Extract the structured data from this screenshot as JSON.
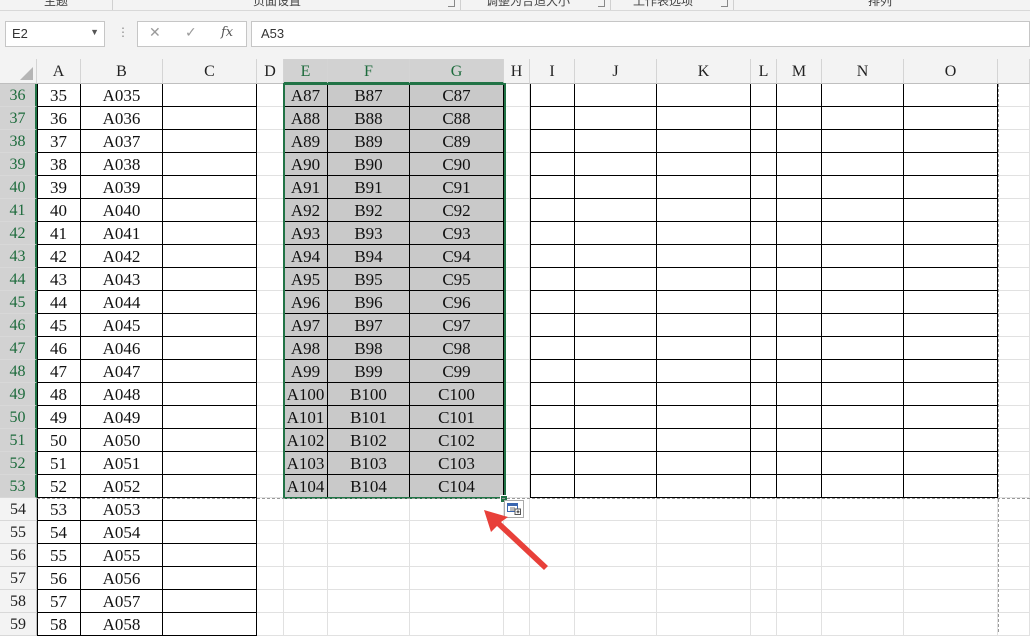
{
  "ribbon": {
    "groups": [
      "主题",
      "页面设置",
      "调整为合适大小",
      "工作表选项",
      "排列"
    ]
  },
  "formula_bar": {
    "name_box": "E2",
    "cancel_icon": "✕",
    "enter_icon": "✓",
    "fx_label": "fx",
    "formula": "A53"
  },
  "sheet": {
    "columns": [
      "A",
      "B",
      "C",
      "D",
      "E",
      "F",
      "G",
      "H",
      "I",
      "J",
      "K",
      "L",
      "M",
      "N",
      "O"
    ],
    "selected_columns": [
      "E",
      "F",
      "G"
    ],
    "rows": [
      {
        "num": "36",
        "a": "35",
        "b": "A035",
        "e": "A87",
        "f": "B87",
        "g": "C87"
      },
      {
        "num": "37",
        "a": "36",
        "b": "A036",
        "e": "A88",
        "f": "B88",
        "g": "C88"
      },
      {
        "num": "38",
        "a": "37",
        "b": "A037",
        "e": "A89",
        "f": "B89",
        "g": "C89"
      },
      {
        "num": "39",
        "a": "38",
        "b": "A038",
        "e": "A90",
        "f": "B90",
        "g": "C90"
      },
      {
        "num": "40",
        "a": "39",
        "b": "A039",
        "e": "A91",
        "f": "B91",
        "g": "C91"
      },
      {
        "num": "41",
        "a": "40",
        "b": "A040",
        "e": "A92",
        "f": "B92",
        "g": "C92"
      },
      {
        "num": "42",
        "a": "41",
        "b": "A041",
        "e": "A93",
        "f": "B93",
        "g": "C93"
      },
      {
        "num": "43",
        "a": "42",
        "b": "A042",
        "e": "A94",
        "f": "B94",
        "g": "C94"
      },
      {
        "num": "44",
        "a": "43",
        "b": "A043",
        "e": "A95",
        "f": "B95",
        "g": "C95"
      },
      {
        "num": "45",
        "a": "44",
        "b": "A044",
        "e": "A96",
        "f": "B96",
        "g": "C96"
      },
      {
        "num": "46",
        "a": "45",
        "b": "A045",
        "e": "A97",
        "f": "B97",
        "g": "C97"
      },
      {
        "num": "47",
        "a": "46",
        "b": "A046",
        "e": "A98",
        "f": "B98",
        "g": "C98"
      },
      {
        "num": "48",
        "a": "47",
        "b": "A047",
        "e": "A99",
        "f": "B99",
        "g": "C99"
      },
      {
        "num": "49",
        "a": "48",
        "b": "A048",
        "e": "A100",
        "f": "B100",
        "g": "C100"
      },
      {
        "num": "50",
        "a": "49",
        "b": "A049",
        "e": "A101",
        "f": "B101",
        "g": "C101"
      },
      {
        "num": "51",
        "a": "50",
        "b": "A050",
        "e": "A102",
        "f": "B102",
        "g": "C102"
      },
      {
        "num": "52",
        "a": "51",
        "b": "A051",
        "e": "A103",
        "f": "B103",
        "g": "C103"
      },
      {
        "num": "53",
        "a": "52",
        "b": "A052",
        "e": "A104",
        "f": "B104",
        "g": "C104"
      },
      {
        "num": "54",
        "a": "53",
        "b": "A053"
      },
      {
        "num": "55",
        "a": "54",
        "b": "A054"
      },
      {
        "num": "56",
        "a": "55",
        "b": "A055"
      },
      {
        "num": "57",
        "a": "56",
        "b": "A056"
      },
      {
        "num": "58",
        "a": "57",
        "b": "A057"
      },
      {
        "num": "59",
        "a": "58",
        "b": "A058"
      }
    ]
  },
  "colors": {
    "selection": "#217346",
    "selected_fill": "#c9c9c9",
    "arrow": "#e8403a"
  },
  "icons": {
    "paste_options": "paste-options-icon",
    "annotation": "red-arrow-icon"
  }
}
